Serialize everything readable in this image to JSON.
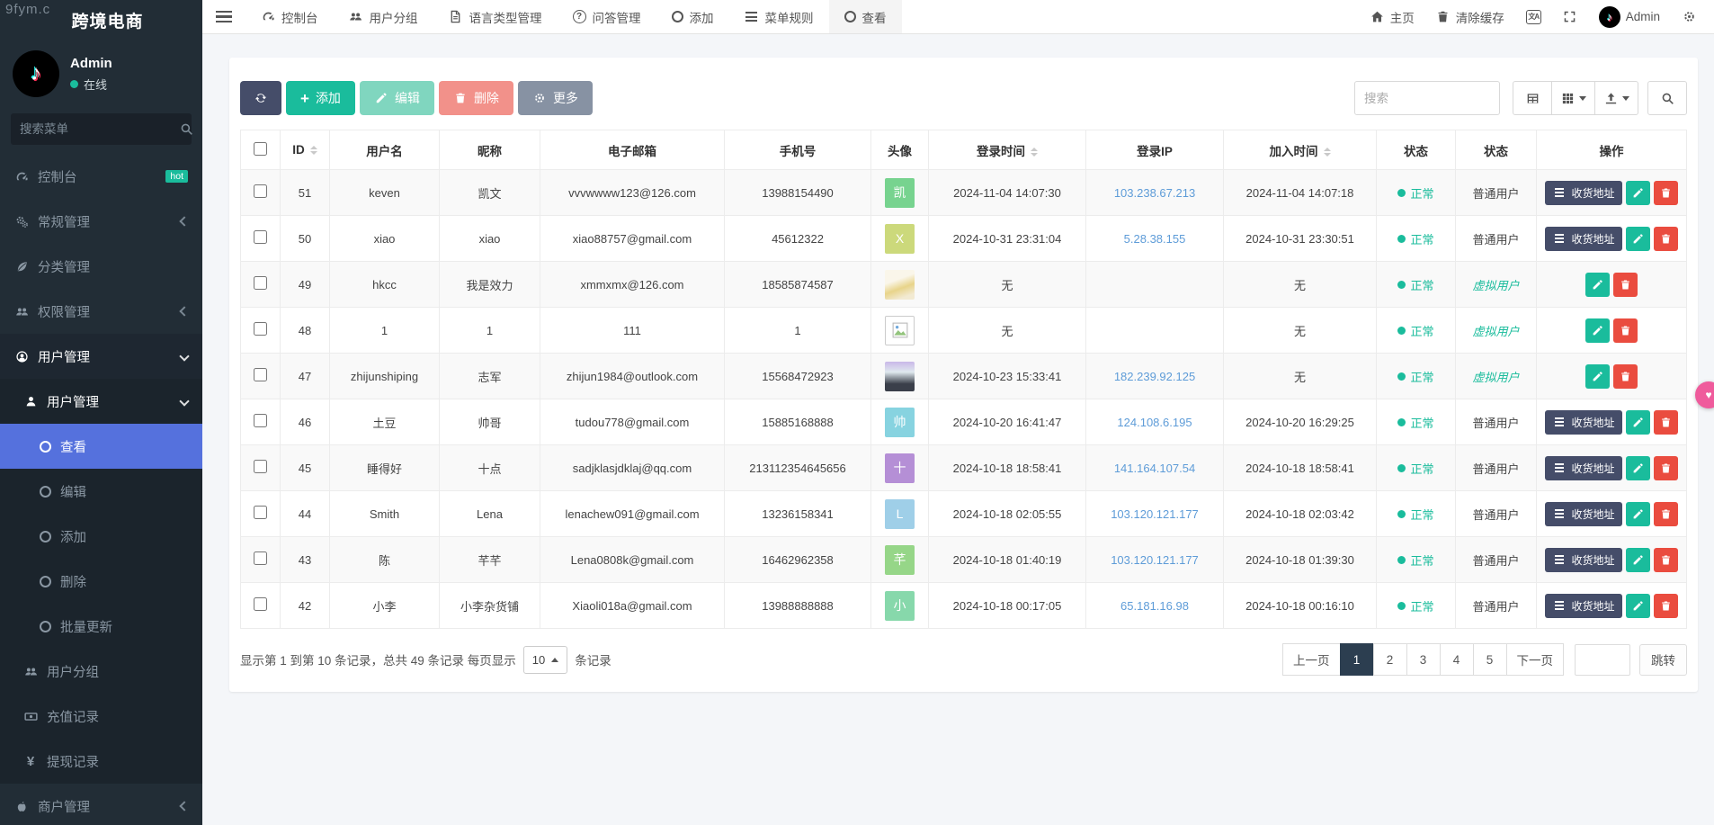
{
  "watermark": "9fym.c",
  "colors": {
    "sidebar_bg": "#222d36",
    "submenu_bg": "#1b242c",
    "active_item_blue": "#5571dd",
    "accent_teal": "#1abc9c",
    "danger_red": "#ea4c3f",
    "dark_button": "#454d69",
    "link_blue": "#5e9cd8",
    "pagination_active": "#2c3e50",
    "floating_pink": "#ef5b9c"
  },
  "sidebar": {
    "title": "跨境电商",
    "user_name": "Admin",
    "user_status": "在线",
    "search_placeholder": "搜索菜单",
    "menu": [
      {
        "label": "控制台",
        "icon": "gauge-icon",
        "depth": 0,
        "badge": "hot"
      },
      {
        "label": "常规管理",
        "icon": "gears-icon",
        "depth": 0,
        "chevron": "left"
      },
      {
        "label": "分类管理",
        "icon": "leaf-icon",
        "depth": 0
      },
      {
        "label": "权限管理",
        "icon": "users-icon",
        "depth": 0,
        "chevron": "left"
      },
      {
        "label": "用户管理",
        "icon": "user-circle-icon",
        "depth": 0,
        "open": true,
        "chevron": "down"
      },
      {
        "label": "用户管理",
        "icon": "user-icon",
        "depth": 1,
        "open": true,
        "chevron": "down"
      },
      {
        "label": "查看",
        "icon": "ring-icon",
        "depth": 2,
        "active": true
      },
      {
        "label": "编辑",
        "icon": "ring-icon",
        "depth": 2
      },
      {
        "label": "添加",
        "icon": "ring-icon",
        "depth": 2
      },
      {
        "label": "删除",
        "icon": "ring-icon",
        "depth": 2
      },
      {
        "label": "批量更新",
        "icon": "ring-icon",
        "depth": 2
      },
      {
        "label": "用户分组",
        "icon": "users-icon",
        "depth": 1
      },
      {
        "label": "充值记录",
        "icon": "banknote-icon",
        "depth": 1
      },
      {
        "label": "提现记录",
        "icon": "yen-icon",
        "depth": 1
      },
      {
        "label": "商户管理",
        "icon": "apple-icon",
        "depth": 0,
        "chevron": "left"
      }
    ]
  },
  "topnav": {
    "tabs": [
      {
        "label": "控制台",
        "icon": "gauge-icon"
      },
      {
        "label": "用户分组",
        "icon": "users-icon"
      },
      {
        "label": "语言类型管理",
        "icon": "file-icon"
      },
      {
        "label": "问答管理",
        "icon": "question-icon"
      },
      {
        "label": "添加",
        "icon": "ring-icon"
      },
      {
        "label": "菜单规则",
        "icon": "bars-icon"
      },
      {
        "label": "查看",
        "icon": "ring-icon",
        "active": true
      }
    ],
    "home_label": "主页",
    "clear_cache_label": "清除缓存",
    "username": "Admin"
  },
  "toolbar": {
    "add_label": "添加",
    "edit_label": "编辑",
    "delete_label": "删除",
    "more_label": "更多",
    "search_placeholder": "搜索"
  },
  "table": {
    "address_button_label": "收货地址",
    "headers": [
      {
        "label": "",
        "type": "checkbox"
      },
      {
        "label": "ID",
        "sortable": true
      },
      {
        "label": "用户名"
      },
      {
        "label": "昵称"
      },
      {
        "label": "电子邮箱"
      },
      {
        "label": "手机号"
      },
      {
        "label": "头像"
      },
      {
        "label": "登录时间",
        "sortable": true
      },
      {
        "label": "登录IP"
      },
      {
        "label": "加入时间",
        "sortable": true
      },
      {
        "label": "状态"
      },
      {
        "label": "状态"
      },
      {
        "label": "操作"
      }
    ],
    "status_normal": "正常",
    "rows": [
      {
        "id": "51",
        "username": "keven",
        "nickname": "凯文",
        "email": "vvvwwww123@126.com",
        "phone": "13988154490",
        "avatar": {
          "type": "text",
          "text": "凯",
          "bg": "#77d38f"
        },
        "login_time": "2024-11-04 14:07:30",
        "login_ip": "103.238.67.213",
        "join_time": "2024-11-04 14:07:18",
        "status": "正常",
        "user_type": "普通用户",
        "actions": [
          "address",
          "edit",
          "delete"
        ]
      },
      {
        "id": "50",
        "username": "xiao",
        "nickname": "xiao",
        "email": "xiao88757@gmail.com",
        "phone": "45612322",
        "avatar": {
          "type": "text",
          "text": "X",
          "bg": "#ccd97b"
        },
        "login_time": "2024-10-31 23:31:04",
        "login_ip": "5.28.38.155",
        "join_time": "2024-10-31 23:30:51",
        "status": "正常",
        "user_type": "普通用户",
        "actions": [
          "address",
          "edit",
          "delete"
        ]
      },
      {
        "id": "49",
        "username": "hkcc",
        "nickname": "我是效力",
        "email": "xmmxmx@126.com",
        "phone": "18585874587",
        "avatar": {
          "type": "photo1"
        },
        "login_time": "无",
        "login_ip": "",
        "join_time": "无",
        "status": "正常",
        "user_type": "虚拟用户",
        "actions": [
          "edit",
          "delete"
        ]
      },
      {
        "id": "48",
        "username": "1",
        "nickname": "1",
        "email": "111",
        "phone": "1",
        "avatar": {
          "type": "broken"
        },
        "login_time": "无",
        "login_ip": "",
        "join_time": "无",
        "status": "正常",
        "user_type": "虚拟用户",
        "actions": [
          "edit",
          "delete"
        ]
      },
      {
        "id": "47",
        "username": "zhijunshiping",
        "nickname": "志军",
        "email": "zhijun1984@outlook.com",
        "phone": "15568472923",
        "avatar": {
          "type": "photo2"
        },
        "login_time": "2024-10-23 15:33:41",
        "login_ip": "182.239.92.125",
        "join_time": "无",
        "status": "正常",
        "user_type": "虚拟用户",
        "actions": [
          "edit",
          "delete"
        ]
      },
      {
        "id": "46",
        "username": "土豆",
        "nickname": "帅哥",
        "email": "tudou778@gmail.com",
        "phone": "15885168888",
        "avatar": {
          "type": "text",
          "text": "帅",
          "bg": "#87d3e0"
        },
        "login_time": "2024-10-20 16:41:47",
        "login_ip": "124.108.6.195",
        "join_time": "2024-10-20 16:29:25",
        "status": "正常",
        "user_type": "普通用户",
        "actions": [
          "address",
          "edit",
          "delete"
        ]
      },
      {
        "id": "45",
        "username": "睡得好",
        "nickname": "十点",
        "email": "sadjklasjdklaj@qq.com",
        "phone": "213112354645656",
        "avatar": {
          "type": "text",
          "text": "十",
          "bg": "#b58fd6"
        },
        "login_time": "2024-10-18 18:58:41",
        "login_ip": "141.164.107.54",
        "join_time": "2024-10-18 18:58:41",
        "status": "正常",
        "user_type": "普通用户",
        "actions": [
          "address",
          "edit",
          "delete"
        ]
      },
      {
        "id": "44",
        "username": "Smith",
        "nickname": "Lena",
        "email": "lenachew091@gmail.com",
        "phone": "13236158341",
        "avatar": {
          "type": "text",
          "text": "L",
          "bg": "#9fcfe8"
        },
        "login_time": "2024-10-18 02:05:55",
        "login_ip": "103.120.121.177",
        "join_time": "2024-10-18 02:03:42",
        "status": "正常",
        "user_type": "普通用户",
        "actions": [
          "address",
          "edit",
          "delete"
        ]
      },
      {
        "id": "43",
        "username": "陈",
        "nickname": "芊芊",
        "email": "Lena0808k@gmail.com",
        "phone": "16462962358",
        "avatar": {
          "type": "text",
          "text": "芊",
          "bg": "#96d688"
        },
        "login_time": "2024-10-18 01:40:19",
        "login_ip": "103.120.121.177",
        "join_time": "2024-10-18 01:39:30",
        "status": "正常",
        "user_type": "普通用户",
        "actions": [
          "address",
          "edit",
          "delete"
        ]
      },
      {
        "id": "42",
        "username": "小李",
        "nickname": "小李杂货铺",
        "email": "Xiaoli018a@gmail.com",
        "phone": "13988888888",
        "avatar": {
          "type": "text",
          "text": "小",
          "bg": "#87d8ab"
        },
        "login_time": "2024-10-18 00:17:05",
        "login_ip": "65.181.16.98",
        "join_time": "2024-10-18 00:16:10",
        "status": "正常",
        "user_type": "普通用户",
        "actions": [
          "address",
          "edit",
          "delete"
        ]
      }
    ]
  },
  "pagination": {
    "info_prefix": "显示第 1 到第 10 条记录，总共 49 条记录 每页显示",
    "page_size": "10",
    "info_suffix": "条记录",
    "prev_label": "上一页",
    "next_label": "下一页",
    "pages": [
      "1",
      "2",
      "3",
      "4",
      "5"
    ],
    "active_page": "1",
    "jump_value": "",
    "jump_label": "跳转"
  }
}
